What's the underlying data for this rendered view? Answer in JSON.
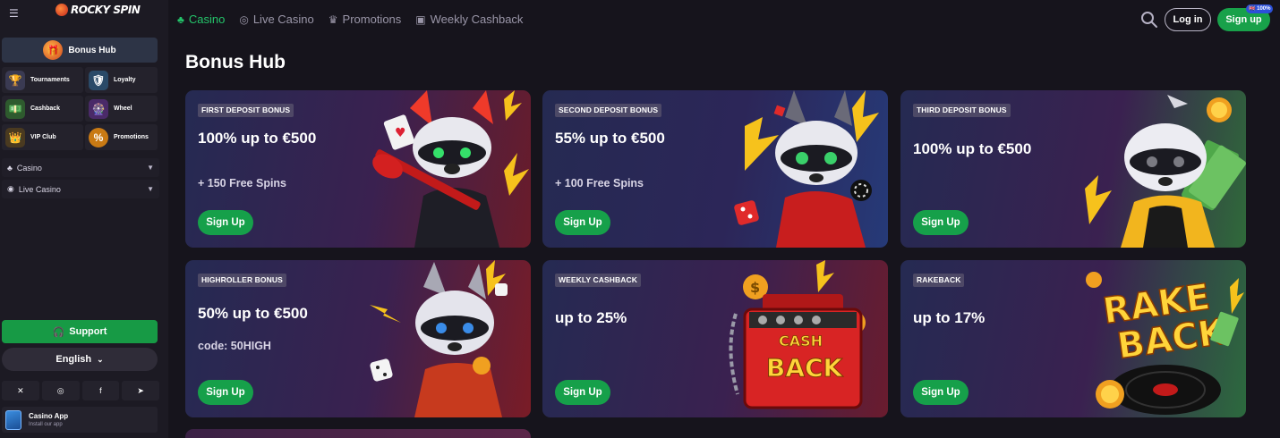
{
  "sidebar": {
    "logo": "ROCKY SPIN",
    "bonus_hub": "Bonus Hub",
    "tiles": [
      {
        "label": "Tournaments",
        "icon": "trophy-icon",
        "color": "#2a3a58"
      },
      {
        "label": "Loyalty",
        "icon": "shield-icon",
        "color": "#2a4a68"
      },
      {
        "label": "Cashback",
        "icon": "cash-icon",
        "color": "#2e4a2e"
      },
      {
        "label": "Wheel",
        "icon": "wheel-icon",
        "color": "#3a2a58"
      },
      {
        "label": "VIP Club",
        "icon": "crown-icon",
        "color": "#4a3a20"
      },
      {
        "label": "Promotions",
        "icon": "percent-icon",
        "color": "#5a3a14"
      }
    ],
    "accordions": [
      "Casino",
      "Live Casino"
    ],
    "support": "Support",
    "language": "English",
    "casino_app": {
      "title": "Casino App",
      "subtitle": "Install our app"
    }
  },
  "topbar": {
    "nav": [
      {
        "label": "Casino",
        "icon": "clover-icon",
        "active": true
      },
      {
        "label": "Live Casino",
        "icon": "live-icon",
        "active": false
      },
      {
        "label": "Promotions",
        "icon": "crown-icon",
        "active": false
      },
      {
        "label": "Weekly Cashback",
        "icon": "gift-icon",
        "active": false
      }
    ],
    "login": "Log in",
    "signup": "Sign up",
    "badge": "🇬🇧 100%"
  },
  "main": {
    "title": "Bonus Hub",
    "cards": [
      {
        "tag": "FIRST DEPOSIT BONUS",
        "headline": "100% up to €500",
        "sub": "+ 150 Free Spins",
        "cta": "Sign Up"
      },
      {
        "tag": "SECOND DEPOSIT BONUS",
        "headline": "55% up to €500",
        "sub": "+ 100 Free Spins",
        "cta": "Sign Up"
      },
      {
        "tag": "THIRD DEPOSIT BONUS",
        "headline": "100% up to €500",
        "sub": "",
        "cta": "Sign Up"
      },
      {
        "tag": "HIGHROLLER BONUS",
        "headline": "50% up to €500",
        "sub": "code: 50HIGH",
        "cta": "Sign Up"
      },
      {
        "tag": "WEEKLY CASHBACK",
        "headline": "up to 25%",
        "sub": "",
        "cta": "Sign Up"
      },
      {
        "tag": "RAKEBACK",
        "headline": "up to 17%",
        "sub": "",
        "cta": "Sign Up"
      }
    ],
    "art_text": {
      "cash": "CASH",
      "back": "BACK",
      "rake": "RAKE",
      "rake_back": "BACK"
    }
  },
  "colors": {
    "accent": "#18a14a",
    "active_nav": "#24c46a"
  }
}
